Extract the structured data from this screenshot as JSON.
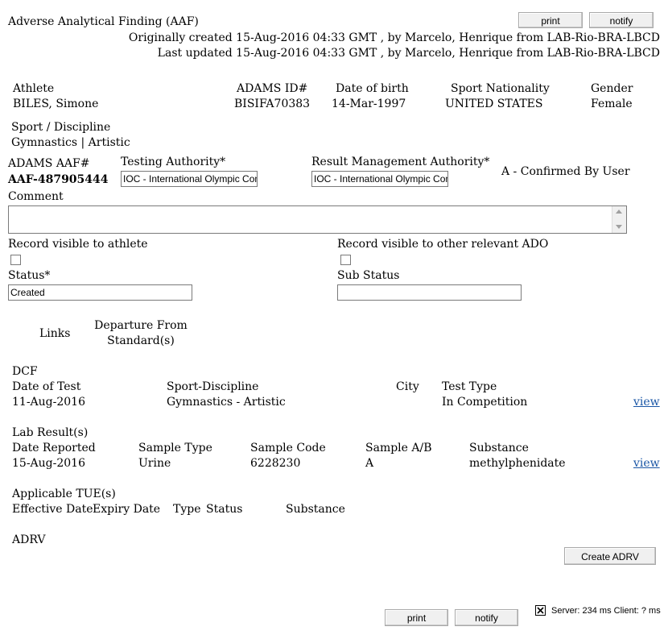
{
  "page": {
    "title": "Adverse Analytical Finding (AAF)",
    "created_line": "Originally created 15-Aug-2016 04:33 GMT , by Marcelo, Henrique from LAB-Rio-BRA-LBCD",
    "updated_line": "Last updated 15-Aug-2016 04:33 GMT , by Marcelo, Henrique from LAB-Rio-BRA-LBCD",
    "print_label": "print",
    "notify_label": "notify"
  },
  "athlete": {
    "headers": {
      "athlete": "Athlete",
      "adams_id": "ADAMS ID#",
      "dob": "Date of birth",
      "nationality": "Sport Nationality",
      "gender": "Gender"
    },
    "name": "BILES, Simone",
    "adams_id": "BISIFA70383",
    "dob": "14-Mar-1997",
    "nationality": "UNITED STATES",
    "gender": "Female",
    "sport_label": "Sport / Discipline",
    "sport": "Gymnastics | Artistic"
  },
  "aaf": {
    "label": "ADAMS AAF#",
    "number": "AAF-487905444",
    "testing_authority_label": "Testing Authority*",
    "testing_authority_value": "IOC - International Olympic Committee",
    "rma_label": "Result Management Authority*",
    "rma_value": "IOC - International Olympic Committee",
    "confirmation": "A - Confirmed By User",
    "comment_label": "Comment",
    "comment_value": "",
    "visible_athlete_label": "Record visible to athlete",
    "visible_ado_label": "Record visible to other relevant ADO",
    "visible_athlete": false,
    "visible_ado": false,
    "status_label": "Status*",
    "status_value": "Created",
    "sub_status_label": "Sub Status",
    "sub_status_value": ""
  },
  "links_section": {
    "links_label": "Links",
    "departure_line1": "Departure From",
    "departure_line2": "Standard(s)"
  },
  "dcf": {
    "title": "DCF",
    "headers": {
      "date": "Date of Test",
      "sport": "Sport-Discipline",
      "city": "City",
      "type": "Test Type"
    },
    "date": "11-Aug-2016",
    "sport": "Gymnastics - Artistic",
    "city": "",
    "type": "In Competition",
    "view_label": "view"
  },
  "lab": {
    "title": "Lab Result(s)",
    "headers": {
      "date": "Date Reported",
      "sample_type": "Sample Type",
      "sample_code": "Sample Code",
      "sample_ab": "Sample A/B",
      "substance": "Substance"
    },
    "date": "15-Aug-2016",
    "sample_type": "Urine",
    "sample_code": "6228230",
    "sample_ab": "A",
    "substance": "methylphenidate",
    "view_label": "view"
  },
  "tue": {
    "title": "Applicable TUE(s)",
    "headers": {
      "effective": "Effective Date",
      "expiry": "Expiry Date",
      "type": "Type",
      "status": "Status",
      "substance": "Substance"
    }
  },
  "adrv": {
    "title": "ADRV",
    "create_label": "Create ADRV"
  },
  "footer": {
    "print_label": "print",
    "notify_label": "notify",
    "server_text": "Server: 234 ms Client: ? ms"
  }
}
